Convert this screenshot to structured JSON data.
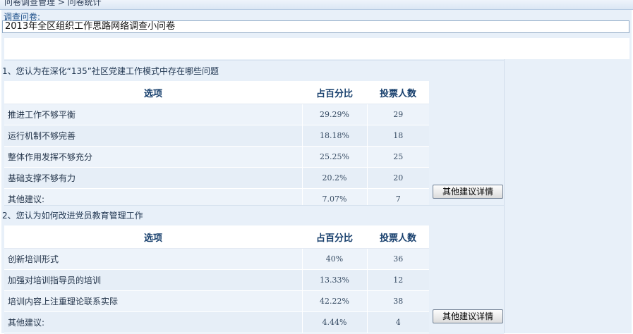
{
  "breadcrumb": "问卷调查管理 > 问卷统计",
  "survey": {
    "label": "调查问卷:",
    "title": "2013年全区组织工作思路网络调查小问卷"
  },
  "questions": [
    {
      "title": "1、您认为在深化“135”社区党建工作模式中存在哪些问题",
      "headers": {
        "option": "选项",
        "percent": "占百分比",
        "votes": "投票人数"
      },
      "rows": [
        {
          "option": "推进工作不够平衡",
          "percent": "29.29%",
          "votes": "29"
        },
        {
          "option": "运行机制不够完善",
          "percent": "18.18%",
          "votes": "18"
        },
        {
          "option": "整体作用发挥不够充分",
          "percent": "25.25%",
          "votes": "25"
        },
        {
          "option": "基础支撑不够有力",
          "percent": "20.2%",
          "votes": "20"
        },
        {
          "option": "其他建议:",
          "percent": "7.07%",
          "votes": "7"
        }
      ],
      "button": "其他建议详情"
    },
    {
      "title": "2、您认为如何改进党员教育管理工作",
      "headers": {
        "option": "选项",
        "percent": "占百分比",
        "votes": "投票人数"
      },
      "rows": [
        {
          "option": "创新培训形式",
          "percent": "40%",
          "votes": "36"
        },
        {
          "option": "加强对培训指导员的培训",
          "percent": "13.33%",
          "votes": "12"
        },
        {
          "option": "培训内容上注重理论联系实际",
          "percent": "42.22%",
          "votes": "38"
        },
        {
          "option": "其他建议:",
          "percent": "4.44%",
          "votes": "4"
        }
      ],
      "button": "其他建议详情"
    }
  ]
}
